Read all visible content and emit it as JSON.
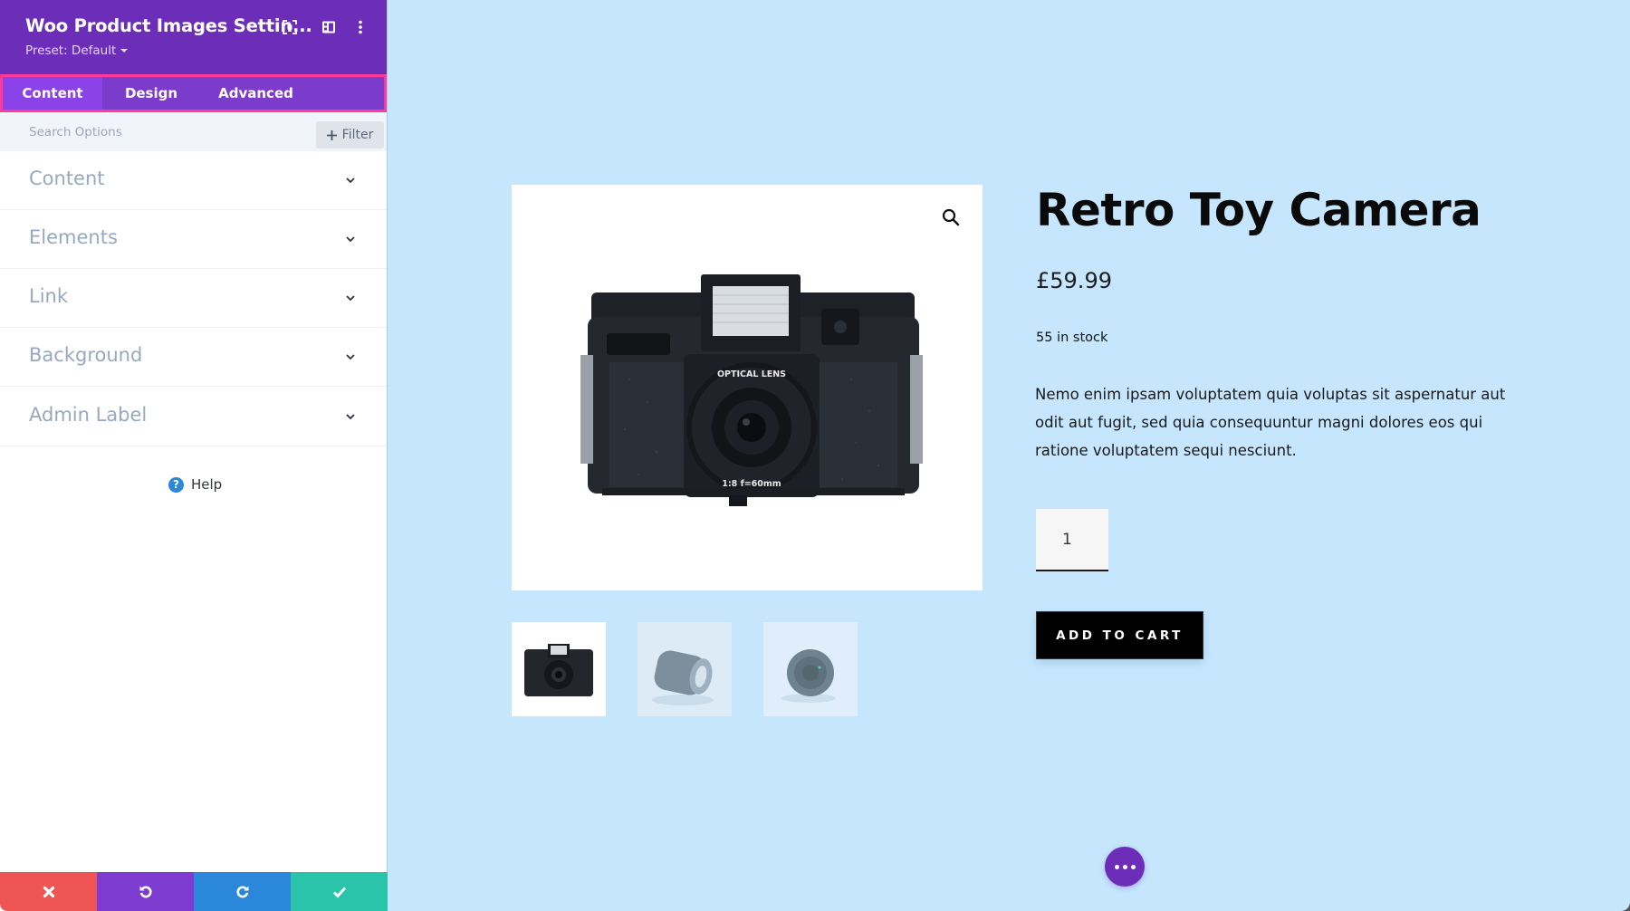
{
  "sidebar": {
    "title": "Woo Product Images Settin...",
    "preset_label": "Preset: Default",
    "header_icons": [
      "focus-mode-icon",
      "split-view-icon",
      "more-options-icon"
    ],
    "tabs": [
      {
        "label": "Content",
        "active": true
      },
      {
        "label": "Design",
        "active": false
      },
      {
        "label": "Advanced",
        "active": false
      }
    ],
    "search": {
      "placeholder": "Search Options",
      "value": ""
    },
    "filter_label": "Filter",
    "sections": [
      {
        "label": "Content"
      },
      {
        "label": "Elements"
      },
      {
        "label": "Link"
      },
      {
        "label": "Background"
      },
      {
        "label": "Admin Label"
      }
    ],
    "help_label": "Help",
    "bottom_actions": [
      {
        "name": "discard",
        "icon": "close-icon",
        "color": "#ef5555"
      },
      {
        "name": "undo",
        "icon": "undo-icon",
        "color": "#7d3bcf"
      },
      {
        "name": "redo",
        "icon": "redo-icon",
        "color": "#2b87da"
      },
      {
        "name": "save",
        "icon": "check-icon",
        "color": "#29c4a9"
      }
    ]
  },
  "colors": {
    "header_purple": "#6c2eb9",
    "tab_active": "#8b42e6",
    "tab_highlight_border": "#ff3b9a",
    "canvas_bg": "#c5e6fd"
  },
  "product": {
    "title": "Retro Toy Camera",
    "price": "£59.99",
    "stock": "55 in stock",
    "description": "Nemo enim ipsam voluptatem quia voluptas sit aspernatur aut odit aut fugit, sed quia consequuntur magni dolores eos qui ratione voluptatem sequi nesciunt.",
    "quantity": "1",
    "add_to_cart_label": "ADD TO CART",
    "main_image": "camera-photo",
    "lens_text_top": "OPTICAL LENS",
    "lens_text_bottom": "1:8  f=60mm",
    "thumbnails": [
      {
        "image": "camera-photo",
        "active": true
      },
      {
        "image": "lens-side-photo",
        "active": false
      },
      {
        "image": "lens-front-photo",
        "active": false
      }
    ]
  }
}
